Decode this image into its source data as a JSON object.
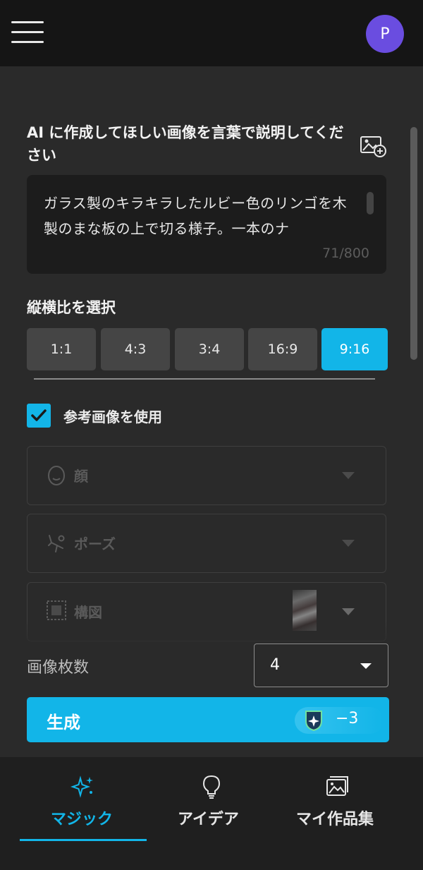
{
  "header": {
    "menu_icon": "hamburger-menu-icon",
    "avatar_initial": "P",
    "avatar_color": "#6a4de0"
  },
  "prompt": {
    "label": "AI に作成してほしい画像を言葉で説明してください",
    "add_image_icon": "image-add-icon",
    "text": "ガラス製のキラキラしたルビー色のリンゴを木製のまな板の上で切る様子。一本のナ",
    "char_count": "71/800"
  },
  "aspect_ratio": {
    "label": "縦横比を選択",
    "options": [
      "1:1",
      "4:3",
      "3:4",
      "16:9",
      "9:16"
    ],
    "selected": "9:16"
  },
  "reference": {
    "checkbox_label": "参考画像を使用",
    "checked": true,
    "face_label": "顔",
    "pose_label": "ポーズ",
    "composition_label": "構図"
  },
  "image_count": {
    "label": "画像枚数",
    "value": "4"
  },
  "generate": {
    "label": "生成",
    "credit_icon": "sparkle-shield-icon",
    "credit_cost": "−3"
  },
  "nav": {
    "items": [
      {
        "label": "マジック",
        "icon": "sparkles-icon",
        "active": true
      },
      {
        "label": "アイデア",
        "icon": "lightbulb-icon",
        "active": false
      },
      {
        "label": "マイ作品集",
        "icon": "gallery-icon",
        "active": false
      }
    ]
  },
  "colors": {
    "accent": "#12b5e8",
    "background": "#2a2a2a",
    "topbar": "#151515",
    "nav_bg": "#1f1f1f"
  }
}
